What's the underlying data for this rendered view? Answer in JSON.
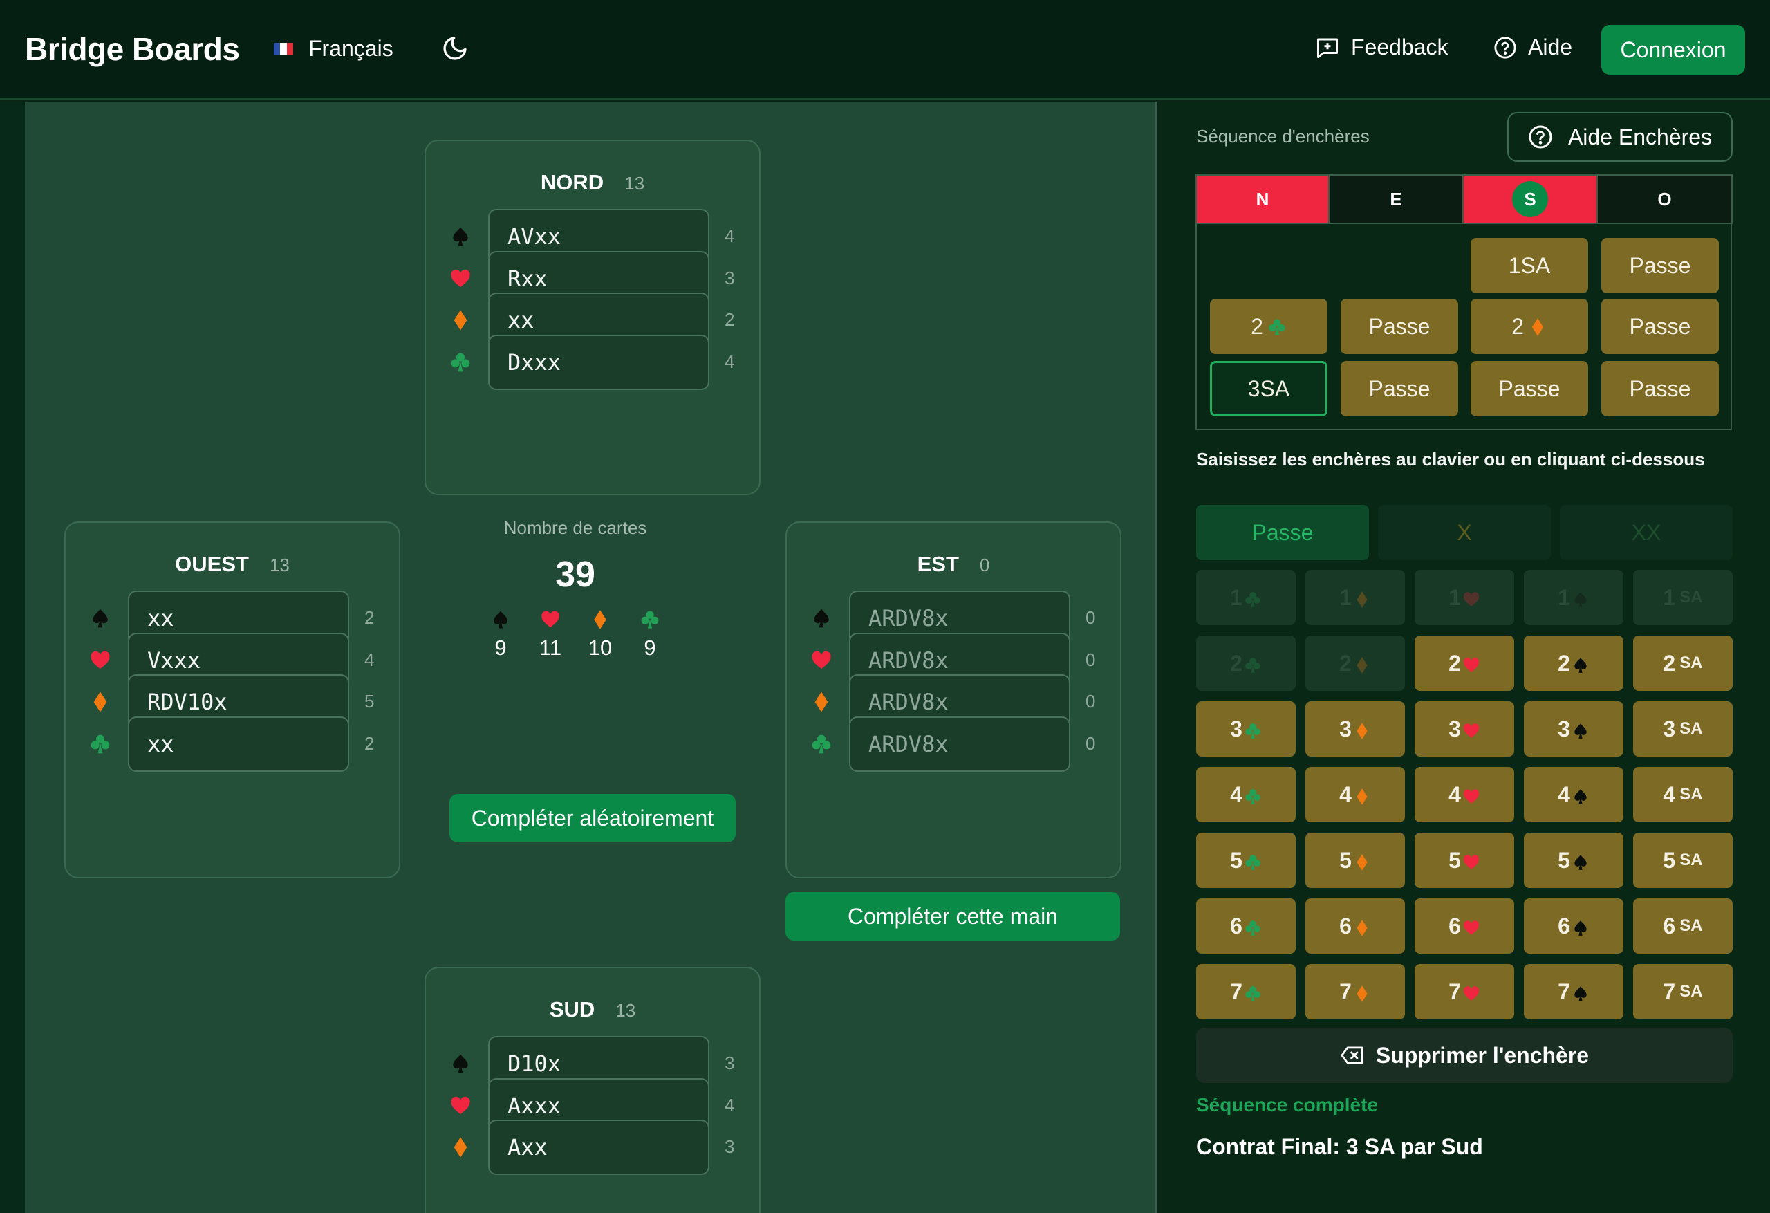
{
  "header": {
    "brand": "Bridge Boards",
    "language": "Français",
    "feedback": "Feedback",
    "aide": "Aide",
    "connexion": "Connexion"
  },
  "colors": {
    "accent": "#0a8a47",
    "heart": "#f0253f",
    "diamond": "#f07a10",
    "club": "#22a055",
    "spade": "#0b0f0c",
    "bid": "#7c6a25"
  },
  "hands": {
    "nord": {
      "name": "NORD",
      "count": "13",
      "suits": [
        {
          "icon": "spade-icon",
          "cards": "AVxx",
          "n": "4"
        },
        {
          "icon": "heart-icon",
          "cards": "Rxx",
          "n": "3"
        },
        {
          "icon": "diamond-icon",
          "cards": "xx",
          "n": "2"
        },
        {
          "icon": "club-icon",
          "cards": "Dxxx",
          "n": "4"
        }
      ]
    },
    "ouest": {
      "name": "OUEST",
      "count": "13",
      "suits": [
        {
          "icon": "spade-icon",
          "cards": "xx",
          "n": "2"
        },
        {
          "icon": "heart-icon",
          "cards": "Vxxx",
          "n": "4"
        },
        {
          "icon": "diamond-icon",
          "cards": "RDV10x",
          "n": "5"
        },
        {
          "icon": "club-icon",
          "cards": "xx",
          "n": "2"
        }
      ]
    },
    "est": {
      "name": "EST",
      "count": "0",
      "placeholder": "ARDV8x",
      "suits": [
        {
          "icon": "spade-icon",
          "cards": "",
          "n": "0"
        },
        {
          "icon": "heart-icon",
          "cards": "",
          "n": "0"
        },
        {
          "icon": "diamond-icon",
          "cards": "",
          "n": "0"
        },
        {
          "icon": "club-icon",
          "cards": "",
          "n": "0"
        }
      ]
    },
    "sud": {
      "name": "SUD",
      "count": "13",
      "suits": [
        {
          "icon": "spade-icon",
          "cards": "D10x",
          "n": "3"
        },
        {
          "icon": "heart-icon",
          "cards": "Axxx",
          "n": "4"
        },
        {
          "icon": "diamond-icon",
          "cards": "Axx",
          "n": "3"
        }
      ]
    }
  },
  "center": {
    "label": "Nombre de cartes",
    "total": "39",
    "suit_counts": [
      {
        "icon": "spade-icon",
        "n": "9"
      },
      {
        "icon": "heart-icon",
        "n": "11"
      },
      {
        "icon": "diamond-icon",
        "n": "10"
      },
      {
        "icon": "club-icon",
        "n": "9"
      }
    ],
    "random_button": "Compléter aléatoirement",
    "complete_hand_button": "Compléter cette main"
  },
  "bidding": {
    "label": "Séquence d'enchères",
    "help_button": "Aide Enchères",
    "columns": [
      "N",
      "E",
      "S",
      "O"
    ],
    "rows": [
      [
        "",
        "",
        "1SA",
        "Passe"
      ],
      [
        "2♣",
        "Passe",
        "2♦",
        "Passe"
      ],
      [
        "3SA",
        "Passe",
        "Passe",
        "Passe"
      ]
    ],
    "hint": "Saisissez les enchères au clavier ou en cliquant ci-dessous",
    "pass": "Passe",
    "double": "X",
    "redouble": "XX",
    "levels": [
      "1",
      "2",
      "3",
      "4",
      "5",
      "6",
      "7"
    ],
    "sa": "SA",
    "delete": "Supprimer l'enchère",
    "status": "Séquence complète",
    "final": "Contrat Final: 3 SA par Sud"
  }
}
